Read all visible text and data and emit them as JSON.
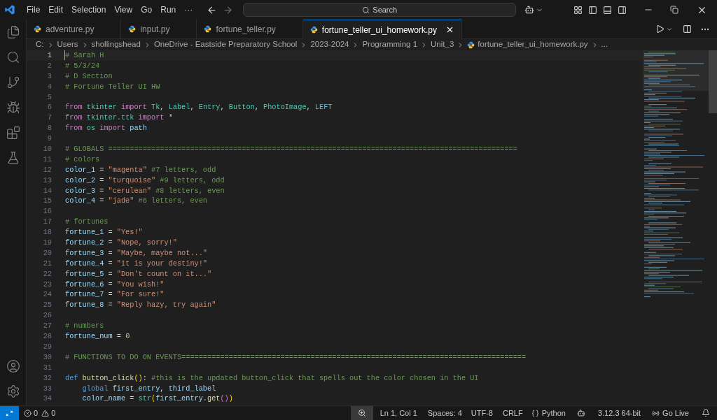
{
  "menu": [
    "File",
    "Edit",
    "Selection",
    "View",
    "Go",
    "Run",
    "···"
  ],
  "search": {
    "label": "Search"
  },
  "tabs": [
    {
      "label": "adventure.py",
      "selected": false
    },
    {
      "label": "input.py",
      "selected": false
    },
    {
      "label": "fortune_teller.py",
      "selected": false
    },
    {
      "label": "fortune_teller_ui_homework.py",
      "selected": true
    }
  ],
  "breadcrumb": [
    {
      "kind": "folder",
      "text": "C:"
    },
    {
      "kind": "folder",
      "text": "Users"
    },
    {
      "kind": "folder",
      "text": "shollingshead"
    },
    {
      "kind": "folder",
      "text": "OneDrive - Eastside Preparatory School"
    },
    {
      "kind": "folder",
      "text": "2023-2024"
    },
    {
      "kind": "folder",
      "text": "Programming 1"
    },
    {
      "kind": "folder",
      "text": "Unit_3"
    },
    {
      "kind": "file",
      "text": "fortune_teller_ui_homework.py"
    },
    {
      "kind": "more",
      "text": "..."
    }
  ],
  "lines": [
    {
      "number": "1",
      "current": true,
      "tokens": [
        {
          "kind": "comment",
          "text": "# Sarah H"
        }
      ]
    },
    {
      "number": "2",
      "current": false,
      "tokens": [
        {
          "kind": "comment",
          "text": "# 5/3/24"
        }
      ]
    },
    {
      "number": "3",
      "current": false,
      "tokens": [
        {
          "kind": "comment",
          "text": "# D Section"
        }
      ]
    },
    {
      "number": "4",
      "current": false,
      "tokens": [
        {
          "kind": "comment",
          "text": "# Fortune Teller UI HW"
        }
      ]
    },
    {
      "number": "5",
      "current": false
    },
    {
      "number": "6",
      "current": false,
      "tokens": [
        {
          "kind": "keyword",
          "text": "from"
        },
        {
          "kind": "module",
          "text": " tkinter"
        },
        {
          "kind": "keyword",
          "text": " import"
        },
        {
          "kind": "module",
          "text": " Tk"
        },
        {
          "kind": "plain",
          "text": ", "
        },
        {
          "kind": "module",
          "text": "Label"
        },
        {
          "kind": "plain",
          "text": ", "
        },
        {
          "kind": "module",
          "text": "Entry"
        },
        {
          "kind": "plain",
          "text": ", "
        },
        {
          "kind": "module",
          "text": "Button"
        },
        {
          "kind": "plain",
          "text": ", "
        },
        {
          "kind": "module",
          "text": "PhotoImage"
        },
        {
          "kind": "plain",
          "text": ", "
        },
        {
          "kind": "constant",
          "text": "LEFT"
        }
      ]
    },
    {
      "number": "7",
      "current": false,
      "tokens": [
        {
          "kind": "keyword",
          "text": "from"
        },
        {
          "kind": "module",
          "text": " tkinter.ttk"
        },
        {
          "kind": "keyword",
          "text": " import"
        },
        {
          "kind": "plain",
          "text": " *"
        }
      ]
    },
    {
      "number": "8",
      "current": false,
      "tokens": [
        {
          "kind": "keyword",
          "text": "from"
        },
        {
          "kind": "module",
          "text": " os"
        },
        {
          "kind": "keyword",
          "text": " import"
        },
        {
          "kind": "variable",
          "text": " path"
        }
      ]
    },
    {
      "number": "9",
      "current": false
    },
    {
      "number": "10",
      "current": false,
      "tokens": [
        {
          "kind": "comment",
          "text": "# GLOBALS ==============================================================================================="
        }
      ]
    },
    {
      "number": "11",
      "current": false,
      "tokens": [
        {
          "kind": "comment",
          "text": "# colors"
        }
      ]
    },
    {
      "number": "12",
      "current": false,
      "tokens": [
        {
          "kind": "variable",
          "text": "color_1"
        },
        {
          "kind": "plain",
          "text": " = "
        },
        {
          "kind": "string",
          "text": "\"magenta\""
        },
        {
          "kind": "comment",
          "text": " #7 letters, odd"
        }
      ]
    },
    {
      "number": "13",
      "current": false,
      "tokens": [
        {
          "kind": "variable",
          "text": "color_2"
        },
        {
          "kind": "plain",
          "text": " = "
        },
        {
          "kind": "string",
          "text": "\"turquoise\""
        },
        {
          "kind": "comment",
          "text": " #9 letters, odd"
        }
      ]
    },
    {
      "number": "14",
      "current": false,
      "tokens": [
        {
          "kind": "variable",
          "text": "color_3"
        },
        {
          "kind": "plain",
          "text": " = "
        },
        {
          "kind": "string",
          "text": "\"cerulean\""
        },
        {
          "kind": "comment",
          "text": " #8 letters, even"
        }
      ]
    },
    {
      "number": "15",
      "current": false,
      "tokens": [
        {
          "kind": "variable",
          "text": "color_4"
        },
        {
          "kind": "plain",
          "text": " = "
        },
        {
          "kind": "string",
          "text": "\"jade\""
        },
        {
          "kind": "comment",
          "text": " #6 letters, even"
        }
      ]
    },
    {
      "number": "16",
      "current": false
    },
    {
      "number": "17",
      "current": false,
      "tokens": [
        {
          "kind": "comment",
          "text": "# fortunes"
        }
      ]
    },
    {
      "number": "18",
      "current": false,
      "tokens": [
        {
          "kind": "variable",
          "text": "fortune_1"
        },
        {
          "kind": "plain",
          "text": " = "
        },
        {
          "kind": "string",
          "text": "\"Yes!\""
        }
      ]
    },
    {
      "number": "19",
      "current": false,
      "tokens": [
        {
          "kind": "variable",
          "text": "fortune_2"
        },
        {
          "kind": "plain",
          "text": " = "
        },
        {
          "kind": "string",
          "text": "\"Nope, sorry!\""
        }
      ]
    },
    {
      "number": "20",
      "current": false,
      "tokens": [
        {
          "kind": "variable",
          "text": "fortune_3"
        },
        {
          "kind": "plain",
          "text": " = "
        },
        {
          "kind": "string",
          "text": "\"Maybe, maybe not...\""
        }
      ]
    },
    {
      "number": "21",
      "current": false,
      "tokens": [
        {
          "kind": "variable",
          "text": "fortune_4"
        },
        {
          "kind": "plain",
          "text": " = "
        },
        {
          "kind": "string",
          "text": "\"It is your destiny!\""
        }
      ]
    },
    {
      "number": "22",
      "current": false,
      "tokens": [
        {
          "kind": "variable",
          "text": "fortune_5"
        },
        {
          "kind": "plain",
          "text": " = "
        },
        {
          "kind": "string",
          "text": "\"Don't count on it...\""
        }
      ]
    },
    {
      "number": "23",
      "current": false,
      "tokens": [
        {
          "kind": "variable",
          "text": "fortune_6"
        },
        {
          "kind": "plain",
          "text": " = "
        },
        {
          "kind": "string",
          "text": "\"You wish!\""
        }
      ]
    },
    {
      "number": "24",
      "current": false,
      "tokens": [
        {
          "kind": "variable",
          "text": "fortune_7"
        },
        {
          "kind": "plain",
          "text": " = "
        },
        {
          "kind": "string",
          "text": "\"For sure!\""
        }
      ]
    },
    {
      "number": "25",
      "current": false,
      "tokens": [
        {
          "kind": "variable",
          "text": "fortune_8"
        },
        {
          "kind": "plain",
          "text": " = "
        },
        {
          "kind": "string",
          "text": "\"Reply hazy, try again\""
        }
      ]
    },
    {
      "number": "26",
      "current": false
    },
    {
      "number": "27",
      "current": false,
      "tokens": [
        {
          "kind": "comment",
          "text": "# numbers"
        }
      ]
    },
    {
      "number": "28",
      "current": false,
      "tokens": [
        {
          "kind": "variable",
          "text": "fortune_num"
        },
        {
          "kind": "plain",
          "text": " = "
        },
        {
          "kind": "number",
          "text": "0"
        }
      ]
    },
    {
      "number": "29",
      "current": false
    },
    {
      "number": "30",
      "current": false,
      "tokens": [
        {
          "kind": "comment",
          "text": "# FUNCTIONS TO DO ON EVENTS================================================================================"
        }
      ]
    },
    {
      "number": "31",
      "current": false
    },
    {
      "number": "32",
      "current": false,
      "tokens": [
        {
          "kind": "storage",
          "text": "def"
        },
        {
          "kind": "function",
          "text": " button_click"
        },
        {
          "kind": "bracket",
          "text": "()"
        },
        {
          "kind": "plain",
          "text": ": "
        },
        {
          "kind": "comment",
          "text": "#this is the updated button_click that spells out the color chosen in the UI"
        }
      ]
    },
    {
      "number": "33",
      "current": false,
      "tokens": [
        {
          "kind": "storage",
          "text": "    global"
        },
        {
          "kind": "variable",
          "text": " first_entry"
        },
        {
          "kind": "plain",
          "text": ", "
        },
        {
          "kind": "variable",
          "text": "third_label"
        }
      ]
    },
    {
      "number": "34",
      "current": false,
      "tokens": [
        {
          "kind": "variable",
          "text": "    color_name"
        },
        {
          "kind": "plain",
          "text": " = "
        },
        {
          "kind": "module",
          "text": "str"
        },
        {
          "kind": "bracket",
          "text": "("
        },
        {
          "kind": "variable",
          "text": "first_entry"
        },
        {
          "kind": "plain",
          "text": "."
        },
        {
          "kind": "function",
          "text": "get"
        },
        {
          "kind": "bracket2",
          "text": "()"
        },
        {
          "kind": "bracket",
          "text": ")"
        }
      ]
    }
  ],
  "status_bar": {
    "errors": "0",
    "warnings": "0",
    "position": "Ln 1, Col 1",
    "indentation": "Spaces: 4",
    "encoding": "UTF-8",
    "eol": "CRLF",
    "language": "Python",
    "interpreter": "3.12.3 64-bit",
    "live": "Go Live"
  }
}
